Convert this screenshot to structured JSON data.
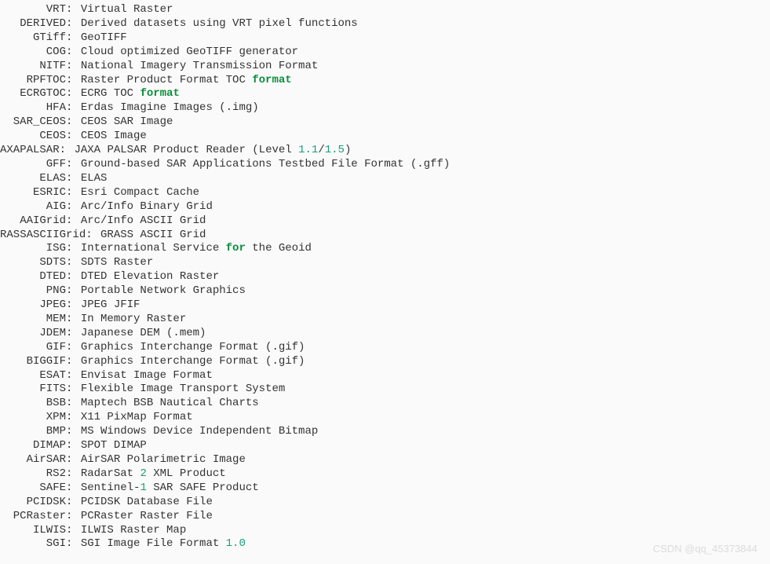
{
  "formats": [
    {
      "key": "VRT",
      "parts": [
        {
          "t": "text",
          "v": "Virtual Raster"
        }
      ]
    },
    {
      "key": "DERIVED",
      "parts": [
        {
          "t": "text",
          "v": "Derived datasets using VRT pixel functions"
        }
      ]
    },
    {
      "key": "GTiff",
      "parts": [
        {
          "t": "text",
          "v": "GeoTIFF"
        }
      ]
    },
    {
      "key": "COG",
      "parts": [
        {
          "t": "text",
          "v": "Cloud optimized GeoTIFF generator"
        }
      ]
    },
    {
      "key": "NITF",
      "parts": [
        {
          "t": "text",
          "v": "National Imagery Transmission Format"
        }
      ]
    },
    {
      "key": "RPFTOC",
      "parts": [
        {
          "t": "text",
          "v": "Raster Product Format TOC "
        },
        {
          "t": "kw",
          "v": "format"
        }
      ]
    },
    {
      "key": "ECRGTOC",
      "parts": [
        {
          "t": "text",
          "v": "ECRG TOC "
        },
        {
          "t": "kw",
          "v": "format"
        }
      ]
    },
    {
      "key": "HFA",
      "parts": [
        {
          "t": "text",
          "v": "Erdas Imagine Images (.img)"
        }
      ]
    },
    {
      "key": "SAR_CEOS",
      "parts": [
        {
          "t": "text",
          "v": "CEOS SAR Image"
        }
      ]
    },
    {
      "key": "CEOS",
      "parts": [
        {
          "t": "text",
          "v": "CEOS Image"
        }
      ]
    },
    {
      "key": "AXAPALSAR",
      "parts": [
        {
          "t": "text",
          "v": "JAXA PALSAR Product Reader (Level "
        },
        {
          "t": "num",
          "v": "1.1"
        },
        {
          "t": "text",
          "v": "/"
        },
        {
          "t": "num",
          "v": "1.5"
        },
        {
          "t": "text",
          "v": ")"
        }
      ],
      "leftExtend": true
    },
    {
      "key": "GFF",
      "parts": [
        {
          "t": "text",
          "v": "Ground-based SAR Applications Testbed File Format (.gff)"
        }
      ]
    },
    {
      "key": "ELAS",
      "parts": [
        {
          "t": "text",
          "v": "ELAS"
        }
      ]
    },
    {
      "key": "ESRIC",
      "parts": [
        {
          "t": "text",
          "v": "Esri Compact Cache"
        }
      ]
    },
    {
      "key": "AIG",
      "parts": [
        {
          "t": "text",
          "v": "Arc/Info Binary Grid"
        }
      ]
    },
    {
      "key": "AAIGrid",
      "parts": [
        {
          "t": "text",
          "v": "Arc/Info ASCII Grid"
        }
      ]
    },
    {
      "key": "RASSASCIIGrid",
      "parts": [
        {
          "t": "text",
          "v": "GRASS ASCII Grid"
        }
      ],
      "leftExtend": true
    },
    {
      "key": "ISG",
      "parts": [
        {
          "t": "text",
          "v": "International Service "
        },
        {
          "t": "kw",
          "v": "for"
        },
        {
          "t": "text",
          "v": " the Geoid"
        }
      ]
    },
    {
      "key": "SDTS",
      "parts": [
        {
          "t": "text",
          "v": "SDTS Raster"
        }
      ]
    },
    {
      "key": "DTED",
      "parts": [
        {
          "t": "text",
          "v": "DTED Elevation Raster"
        }
      ]
    },
    {
      "key": "PNG",
      "parts": [
        {
          "t": "text",
          "v": "Portable Network Graphics"
        }
      ]
    },
    {
      "key": "JPEG",
      "parts": [
        {
          "t": "text",
          "v": "JPEG JFIF"
        }
      ]
    },
    {
      "key": "MEM",
      "parts": [
        {
          "t": "text",
          "v": "In Memory Raster"
        }
      ]
    },
    {
      "key": "JDEM",
      "parts": [
        {
          "t": "text",
          "v": "Japanese DEM (.mem)"
        }
      ]
    },
    {
      "key": "GIF",
      "parts": [
        {
          "t": "text",
          "v": "Graphics Interchange Format (.gif)"
        }
      ]
    },
    {
      "key": "BIGGIF",
      "parts": [
        {
          "t": "text",
          "v": "Graphics Interchange Format (.gif)"
        }
      ]
    },
    {
      "key": "ESAT",
      "parts": [
        {
          "t": "text",
          "v": "Envisat Image Format"
        }
      ]
    },
    {
      "key": "FITS",
      "parts": [
        {
          "t": "text",
          "v": "Flexible Image Transport System"
        }
      ]
    },
    {
      "key": "BSB",
      "parts": [
        {
          "t": "text",
          "v": "Maptech BSB Nautical Charts"
        }
      ]
    },
    {
      "key": "XPM",
      "parts": [
        {
          "t": "text",
          "v": "X11 PixMap Format"
        }
      ]
    },
    {
      "key": "BMP",
      "parts": [
        {
          "t": "text",
          "v": "MS Windows Device Independent Bitmap"
        }
      ]
    },
    {
      "key": "DIMAP",
      "parts": [
        {
          "t": "text",
          "v": "SPOT DIMAP"
        }
      ]
    },
    {
      "key": "AirSAR",
      "parts": [
        {
          "t": "text",
          "v": "AirSAR Polarimetric Image"
        }
      ]
    },
    {
      "key": "RS2",
      "parts": [
        {
          "t": "text",
          "v": "RadarSat "
        },
        {
          "t": "num",
          "v": "2"
        },
        {
          "t": "text",
          "v": " XML Product"
        }
      ]
    },
    {
      "key": "SAFE",
      "parts": [
        {
          "t": "text",
          "v": "Sentinel-"
        },
        {
          "t": "num",
          "v": "1"
        },
        {
          "t": "text",
          "v": " SAR SAFE Product"
        }
      ]
    },
    {
      "key": "PCIDSK",
      "parts": [
        {
          "t": "text",
          "v": "PCIDSK Database File"
        }
      ]
    },
    {
      "key": "PCRaster",
      "parts": [
        {
          "t": "text",
          "v": "PCRaster Raster File"
        }
      ]
    },
    {
      "key": "ILWIS",
      "parts": [
        {
          "t": "text",
          "v": "ILWIS Raster Map"
        }
      ]
    },
    {
      "key": "SGI",
      "parts": [
        {
          "t": "text",
          "v": "SGI Image File Format "
        },
        {
          "t": "num",
          "v": "1.0"
        }
      ]
    }
  ],
  "watermark": "CSDN @qq_45373844",
  "keyWidth": 84
}
